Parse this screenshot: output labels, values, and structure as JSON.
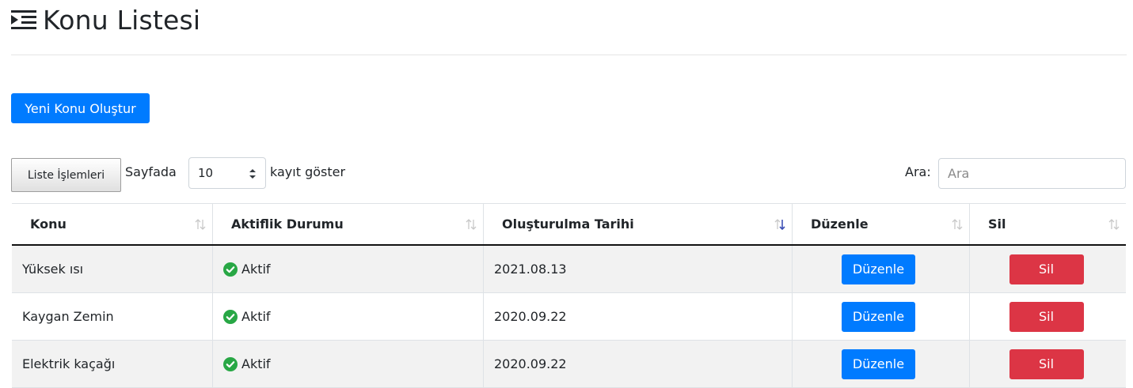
{
  "header": {
    "title": "Konu Listesi",
    "icon": "list-indent-icon"
  },
  "actions": {
    "new_topic_label": "Yeni Konu Oluştur",
    "list_ops_label": "Liste İşlemleri"
  },
  "length": {
    "prefix": "Sayfada",
    "value": "10",
    "suffix": "kayıt göster"
  },
  "search": {
    "label": "Ara:",
    "placeholder": "Ara"
  },
  "table": {
    "columns": [
      {
        "label": "Konu",
        "sort": "none"
      },
      {
        "label": "Aktiflik Durumu",
        "sort": "none"
      },
      {
        "label": "Oluşturulma Tarihi",
        "sort": "desc"
      },
      {
        "label": "Düzenle",
        "sort": "none"
      },
      {
        "label": "Sil",
        "sort": "none"
      }
    ],
    "rows": [
      {
        "topic": "Yüksek ısı",
        "status": "Aktif",
        "date": "2021.08.13",
        "edit": "Düzenle",
        "delete": "Sil"
      },
      {
        "topic": "Kaygan Zemin",
        "status": "Aktif",
        "date": "2020.09.22",
        "edit": "Düzenle",
        "delete": "Sil"
      },
      {
        "topic": "Elektrik kaçağı",
        "status": "Aktif",
        "date": "2020.09.22",
        "edit": "Düzenle",
        "delete": "Sil"
      }
    ]
  },
  "colors": {
    "primary": "#007bff",
    "danger": "#dc3545",
    "success": "#28a745",
    "sort_active": "#3f51b5"
  }
}
